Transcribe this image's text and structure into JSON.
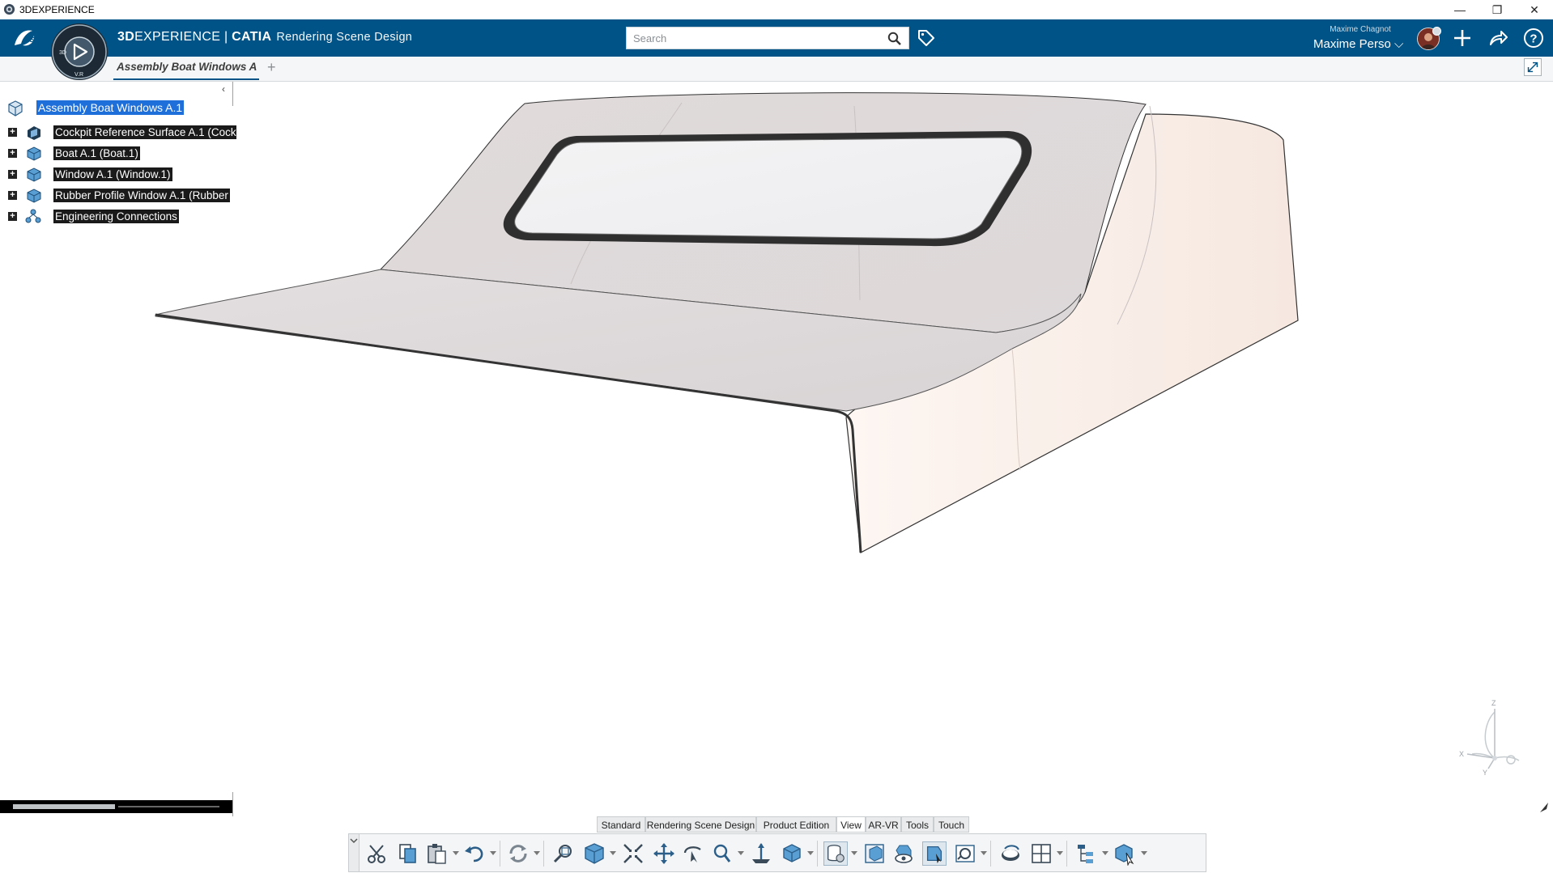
{
  "window": {
    "title": "3DEXPERIENCE",
    "controls": [
      "minimize",
      "restore",
      "close"
    ]
  },
  "appbar": {
    "brand_bold": "3D",
    "brand_rest": "EXPERIENCE | ",
    "brand_catia": "CATIA",
    "app_name": "Rendering Scene Design",
    "search_placeholder": "Search",
    "user_small": "Maxime Chagnot",
    "user_name": "Maxime Perso ⌵"
  },
  "compass": {
    "label_left": "3D",
    "label_right": "V.R"
  },
  "tabs": {
    "active": "Assembly Boat Windows A",
    "add": "+"
  },
  "tree": {
    "collapse_glyph": "‹",
    "root": {
      "label": "Assembly Boat Windows A.1",
      "icon": "product-icon"
    },
    "children": [
      {
        "label": "Cockpit Reference Surface A.1 (Cock",
        "icon": "shape-icon"
      },
      {
        "label": "Boat A.1 (Boat.1)",
        "icon": "part-icon"
      },
      {
        "label": "Window A.1 (Window.1)",
        "icon": "part-icon"
      },
      {
        "label": "Rubber Profile Window A.1 (Rubber",
        "icon": "part-icon"
      },
      {
        "label": "Engineering Connections",
        "icon": "connections-icon"
      }
    ]
  },
  "axis": {
    "x": "X",
    "y": "Y",
    "z": "Z"
  },
  "action_sections": [
    "Standard",
    "Rendering Scene Design",
    "Product Edition",
    "View",
    "AR-VR",
    "Tools",
    "Touch"
  ],
  "active_section": "View",
  "tools": [
    "cut-icon",
    "copy-icon",
    "paste-icon",
    "undo-icon",
    "update-icon",
    "zoom-area-icon",
    "view-orientation-icon",
    "fit-all-icon",
    "pan-icon",
    "rotate-icon",
    "zoom-icon",
    "normal-view-icon",
    "render-style-icon",
    "ambiance-icon",
    "clipping-icon",
    "hide-show-icon",
    "swap-visible-icon",
    "look-at-icon",
    "capture-icon",
    "layout-grid-icon",
    "tree-icon",
    "cube-cursor-icon"
  ],
  "colors": {
    "appbar_bg": "#005386",
    "selection_bg": "#1e6fd9",
    "tree_label_bg": "#1a1a1a",
    "model_surface": "#efe6e2"
  }
}
